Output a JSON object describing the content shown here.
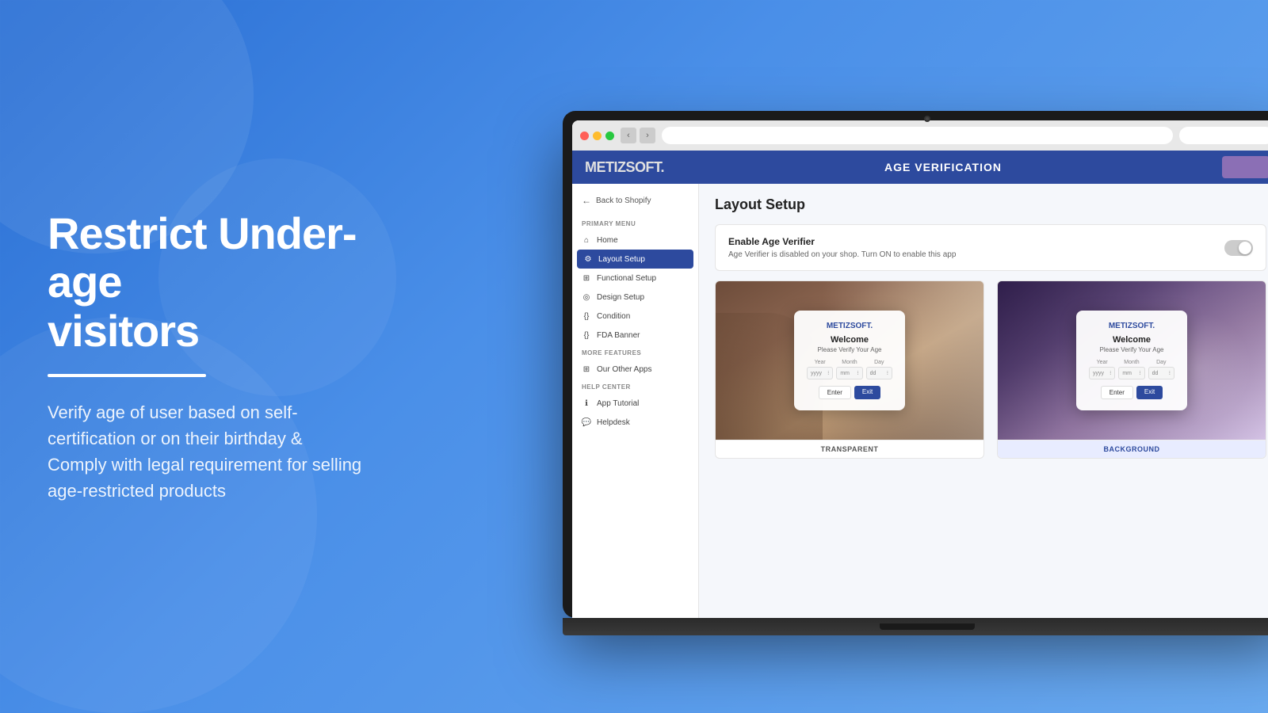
{
  "background": {
    "gradient_start": "#2a6fd4",
    "gradient_end": "#6aaaf0"
  },
  "left_panel": {
    "heading_line1": "Restrict Under-age",
    "heading_line2": "visitors",
    "description": "Verify age of user based on self-certification or on their birthday & Comply with legal requirement for selling age-restricted products"
  },
  "browser": {
    "address_bar_value": ""
  },
  "app": {
    "logo": "METIZSOFT.",
    "logo_dot_color": "#e0e0e0",
    "title": "AGE VERIFICATION",
    "back_button_label": "Back to Shopify",
    "primary_menu_label": "PRIMARY MENU",
    "menu_items": [
      {
        "label": "Home",
        "icon": "home",
        "active": false
      },
      {
        "label": "Layout Setup",
        "icon": "gear",
        "active": true
      },
      {
        "label": "Functional Setup",
        "icon": "grid",
        "active": false
      },
      {
        "label": "Design Setup",
        "icon": "eye",
        "active": false
      },
      {
        "label": "Condition",
        "icon": "brackets",
        "active": false
      },
      {
        "label": "FDA Banner",
        "icon": "brackets",
        "active": false
      }
    ],
    "more_features_label": "MORE FEATURES",
    "more_features_items": [
      {
        "label": "Our Other Apps",
        "icon": "grid"
      }
    ],
    "help_center_label": "HELP CENTER",
    "help_center_items": [
      {
        "label": "App Tutorial",
        "icon": "info"
      },
      {
        "label": "Helpdesk",
        "icon": "chat"
      }
    ],
    "page_title": "Layout Setup",
    "enable_card": {
      "title": "Enable Age Verifier",
      "description": "Age Verifier is disabled on your shop. Turn ON to enable this app",
      "toggle_state": "off"
    },
    "themes": [
      {
        "id": "transparent",
        "label": "TRANSPARENT",
        "selected": false,
        "modal": {
          "logo": "METIZSOFT.",
          "welcome": "Welcome",
          "subtitle": "Please Verify Your Age",
          "year_label": "Year",
          "month_label": "Month",
          "day_label": "Day",
          "year_placeholder": "yyyy",
          "month_placeholder": "mm",
          "day_placeholder": "dd",
          "enter_btn": "Enter",
          "exit_btn": "Exit"
        }
      },
      {
        "id": "background",
        "label": "BACKGROUND",
        "selected": true,
        "modal": {
          "logo": "METIZSOFT.",
          "welcome": "Welcome",
          "subtitle": "Please Verify Your Age",
          "year_label": "Year",
          "month_label": "Month",
          "day_label": "Day",
          "year_placeholder": "yyyy",
          "month_placeholder": "mm",
          "day_placeholder": "dd",
          "enter_btn": "Enter",
          "exit_btn": "Exit"
        }
      }
    ]
  }
}
